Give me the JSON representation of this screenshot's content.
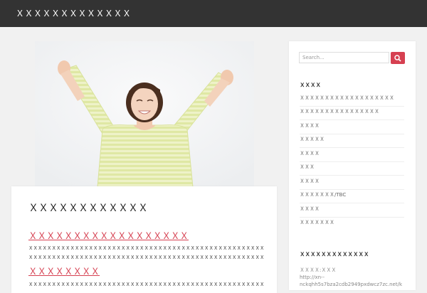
{
  "header": {
    "site_title": "ＸＸＸＸＸＸＸＸＸＸＸＸＸ",
    "bg_color": "#333333"
  },
  "hero": {
    "description_icon": "photo-woman-celebrating-icon"
  },
  "article": {
    "title": "ＸＸＸＸＸＸＸＸＸＸＸＸ",
    "sections": [
      {
        "heading": "ＸＸＸＸＸＸＸＸＸＸＸＸＸＸＸＸＸＸ",
        "lines": [
          "ＸＸＸＸＸＸＸＸＸＸＸＸＸＸＸＸＸＸＸＸＸＸＸＸＸＸＸＸＸＸＸＸＸＸＸＸＸＸＸＸＸＸＸＸＸＸＸＸＸＸＸＸＸＸＸＸＸＸＸＸＸＸＸＸＸＸ",
          "ＸＸＸＸＸＸＸＸＸＸＸＸＸＸＸＸＸＸＸＸＸＸＸＸＸＸＸＸＸＸＸＸＸＸＸＸＸＸＸＸＸＸＸＸＸＸＸＸＸＸＸＸＸＸＸＸＸＸＸＸＸＸＸ"
        ]
      },
      {
        "heading": "ＸＸＸＸＸＸＸＸ",
        "lines": [
          "ＸＸＸＸＸＸＸＸＸＸＸＸＸＸＸＸＸＸＸＸＸＸＸＸＸＸＸＸＸＸＸＸＸＸＸＸＸＸＸＸＸＸＸＸＸＸＸＸＸＸＸＸＸＸＸＸＸＸＸＸＸＸＸＸＸＸ"
        ]
      }
    ],
    "accent_color": "#d64051"
  },
  "sidebar": {
    "search": {
      "placeholder": "Search...",
      "icon": "search-icon",
      "button_color": "#d64051"
    },
    "categories_title": "ＸＸＸＸ",
    "categories": [
      "ＸＸＸＸＸＸＸＸＸＸＸＸＸＸＸＸＸＸＸ",
      "ＸＸＸＸＸＸＸＸＸＸＸＸＸＸＸＸ",
      "ＸＸＸＸ",
      "ＸＸＸＸＸ",
      "ＸＸＸＸ",
      "ＸＸＸ",
      "ＸＸＸＸ",
      "ＸＸＸＸＸＸＸ/TBC",
      "ＸＸＸＸ",
      "ＸＸＸＸＸＸＸ"
    ],
    "meta_title": "ＸＸＸＸＸＸＸＸＸＸＸＸＸ",
    "meta_lines": [
      "ＸＸＸＸ:ＸＸＸ",
      "http://xn--",
      "nckqhh5s7bza2cdb2949pxdwcz7zc.net/k"
    ]
  }
}
